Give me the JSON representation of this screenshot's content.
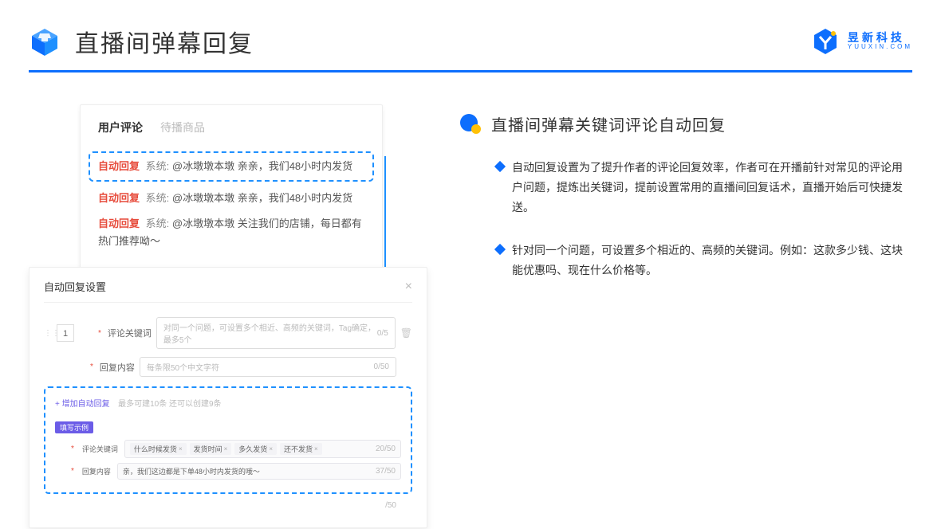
{
  "header": {
    "title": "直播间弹幕回复",
    "brand_name": "昱新科技",
    "brand_domain": "YUUXIN.COM"
  },
  "comments": {
    "tab_active": "用户评论",
    "tab_inactive": "待播商品",
    "items": [
      {
        "tag": "自动回复",
        "sys": "系统:",
        "text": "@冰墩墩本墩 亲亲，我们48小时内发货"
      },
      {
        "tag": "自动回复",
        "sys": "系统:",
        "text": "@冰墩墩本墩 亲亲，我们48小时内发货"
      },
      {
        "tag": "自动回复",
        "sys": "系统:",
        "text": "@冰墩墩本墩 关注我们的店铺，每日都有热门推荐呦～"
      }
    ]
  },
  "settings": {
    "title": "自动回复设置",
    "order": "1",
    "keyword_label": "评论关键词",
    "keyword_placeholder": "对同一个问题，可设置多个相近、高频的关键词，Tag确定，最多5个",
    "keyword_counter": "0/5",
    "content_label": "回复内容",
    "content_placeholder": "每条限50个中文字符",
    "content_counter": "0/50",
    "add_link_text": "+ 增加自动回复",
    "add_hint": "最多可建10条 还可以创建9条",
    "example_badge": "填写示例",
    "example_keyword_label": "评论关键词",
    "example_tags": [
      "什么时候发货",
      "发货时间",
      "多久发货",
      "还不发货"
    ],
    "example_keyword_counter": "20/50",
    "example_content_label": "回复内容",
    "example_content_text": "亲，我们这边都是下单48小时内发货的哦～",
    "example_content_counter": "37/50",
    "footer_counter": "/50"
  },
  "right": {
    "section_title": "直播间弹幕关键词评论自动回复",
    "bullets": [
      "自动回复设置为了提升作者的评论回复效率，作者可在开播前针对常见的评论用户问题，提炼出关键词，提前设置常用的直播间回复话术，直播开始后可快捷发送。",
      "针对同一个问题，可设置多个相近的、高频的关键词。例如：这款多少钱、这块能优惠吗、现在什么价格等。"
    ]
  }
}
